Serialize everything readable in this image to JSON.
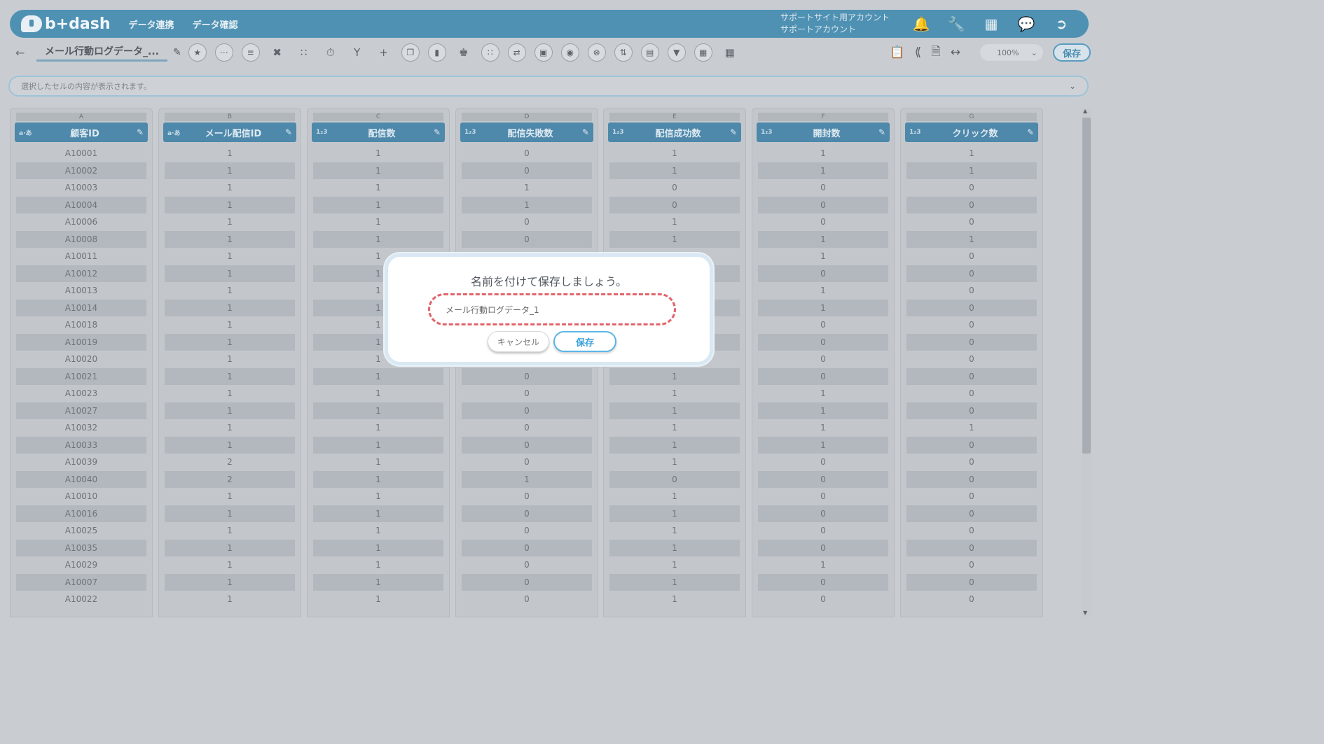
{
  "header": {
    "logo_text": "b+dash",
    "nav": [
      "データ連携",
      "データ確認"
    ],
    "account_line1": "サポートサイト用アカウント",
    "account_line2": "サポートアカウント"
  },
  "toolbar": {
    "back_glyph": "←",
    "doc_title": "メール行動ログデータ_...",
    "zoom": "100%",
    "save_label": "保存"
  },
  "cellbar": {
    "placeholder": "選択したセルの内容が表示されます。"
  },
  "columns": [
    {
      "letter": "A",
      "type": "a∙あ",
      "name": "顧客ID"
    },
    {
      "letter": "B",
      "type": "a∙あ",
      "name": "メール配信ID"
    },
    {
      "letter": "C",
      "type": "1₂3",
      "name": "配信数"
    },
    {
      "letter": "D",
      "type": "1₂3",
      "name": "配信失敗数"
    },
    {
      "letter": "E",
      "type": "1₂3",
      "name": "配信成功数"
    },
    {
      "letter": "F",
      "type": "1₂3",
      "name": "開封数"
    },
    {
      "letter": "G",
      "type": "1₂3",
      "name": "クリック数"
    }
  ],
  "rows": [
    [
      "A10001",
      "1",
      "1",
      "0",
      "1",
      "1",
      "1"
    ],
    [
      "A10002",
      "1",
      "1",
      "0",
      "1",
      "1",
      "1"
    ],
    [
      "A10003",
      "1",
      "1",
      "1",
      "0",
      "0",
      "0"
    ],
    [
      "A10004",
      "1",
      "1",
      "1",
      "0",
      "0",
      "0"
    ],
    [
      "A10006",
      "1",
      "1",
      "0",
      "1",
      "0",
      "0"
    ],
    [
      "A10008",
      "1",
      "1",
      "0",
      "1",
      "1",
      "1"
    ],
    [
      "A10011",
      "1",
      "1",
      "",
      "",
      "1",
      "0"
    ],
    [
      "A10012",
      "1",
      "1",
      "",
      "",
      "0",
      "0"
    ],
    [
      "A10013",
      "1",
      "1",
      "",
      "",
      "1",
      "0"
    ],
    [
      "A10014",
      "1",
      "1",
      "",
      "",
      "1",
      "0"
    ],
    [
      "A10018",
      "1",
      "1",
      "",
      "",
      "0",
      "0"
    ],
    [
      "A10019",
      "1",
      "1",
      "",
      "",
      "0",
      "0"
    ],
    [
      "A10020",
      "1",
      "1",
      "",
      "",
      "0",
      "0"
    ],
    [
      "A10021",
      "1",
      "1",
      "0",
      "1",
      "0",
      "0"
    ],
    [
      "A10023",
      "1",
      "1",
      "0",
      "1",
      "1",
      "0"
    ],
    [
      "A10027",
      "1",
      "1",
      "0",
      "1",
      "1",
      "0"
    ],
    [
      "A10032",
      "1",
      "1",
      "0",
      "1",
      "1",
      "1"
    ],
    [
      "A10033",
      "1",
      "1",
      "0",
      "1",
      "1",
      "0"
    ],
    [
      "A10039",
      "2",
      "1",
      "0",
      "1",
      "0",
      "0"
    ],
    [
      "A10040",
      "2",
      "1",
      "1",
      "0",
      "0",
      "0"
    ],
    [
      "A10010",
      "1",
      "1",
      "0",
      "1",
      "0",
      "0"
    ],
    [
      "A10016",
      "1",
      "1",
      "0",
      "1",
      "0",
      "0"
    ],
    [
      "A10025",
      "1",
      "1",
      "0",
      "1",
      "0",
      "0"
    ],
    [
      "A10035",
      "1",
      "1",
      "0",
      "1",
      "0",
      "0"
    ],
    [
      "A10029",
      "1",
      "1",
      "0",
      "1",
      "1",
      "0"
    ],
    [
      "A10007",
      "1",
      "1",
      "0",
      "1",
      "0",
      "0"
    ],
    [
      "A10022",
      "1",
      "1",
      "0",
      "1",
      "0",
      "0"
    ]
  ],
  "modal": {
    "title": "名前を付けて保存しましょう。",
    "input_value": "メール行動ログデータ_1",
    "cancel_label": "キャンセル",
    "save_label": "保存"
  }
}
